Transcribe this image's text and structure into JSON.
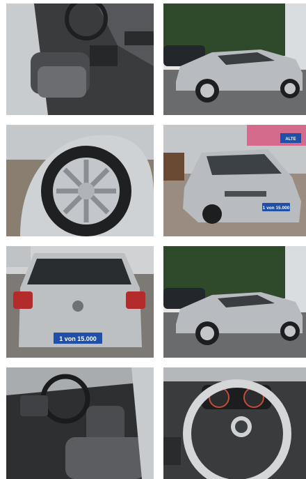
{
  "gallery": {
    "photos": [
      {
        "subject": "interior-driver-seat"
      },
      {
        "subject": "exterior-side"
      },
      {
        "subject": "wheel-closeup"
      },
      {
        "subject": "exterior-front"
      },
      {
        "subject": "exterior-rear",
        "plate_text": "1 von 15.000"
      },
      {
        "subject": "exterior-side"
      },
      {
        "subject": "interior-seats"
      },
      {
        "subject": "steering-wheel-dashboard"
      }
    ],
    "front_plate_text": "1 von 15.000",
    "dealer_sign_text": "ALTE\nLIEBE"
  },
  "colors": {
    "car_silver": "#b8bcc0",
    "interior_dark": "#2e2f31",
    "plate_blue": "#1f4fa8",
    "foliage": "#2f4a2a"
  }
}
